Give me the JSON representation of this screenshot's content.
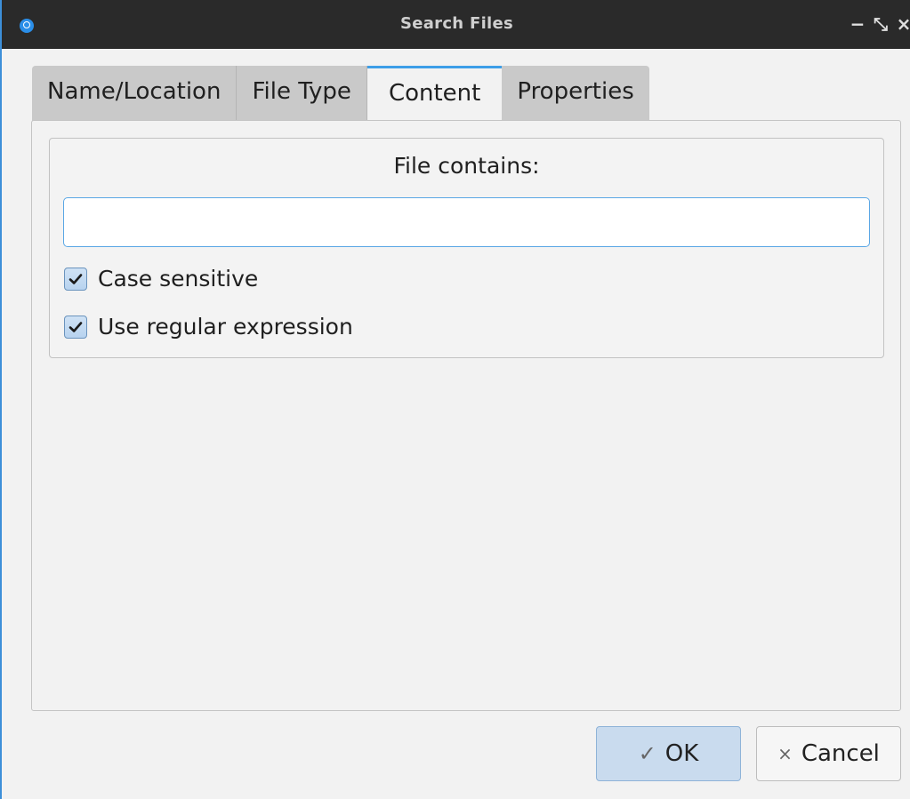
{
  "window": {
    "title": "Search Files",
    "minimize_glyph": "−",
    "restore_glyph": "⤡",
    "close_glyph": "×"
  },
  "tabs": [
    {
      "label": "Name/Location",
      "active": false
    },
    {
      "label": "File Type",
      "active": false
    },
    {
      "label": "Content",
      "active": true
    },
    {
      "label": "Properties",
      "active": false
    }
  ],
  "content": {
    "group_title": "File contains:",
    "search_value": "",
    "case_sensitive": {
      "label": "Case sensitive",
      "checked": true
    },
    "regex": {
      "label": "Use regular expression",
      "checked": true
    }
  },
  "buttons": {
    "ok_icon": "✓",
    "ok_label": "OK",
    "cancel_icon": "×",
    "cancel_label": "Cancel"
  },
  "colors": {
    "accent": "#3d9ee8",
    "titlebar": "#2a2a2a",
    "background": "#f2f2f2"
  }
}
